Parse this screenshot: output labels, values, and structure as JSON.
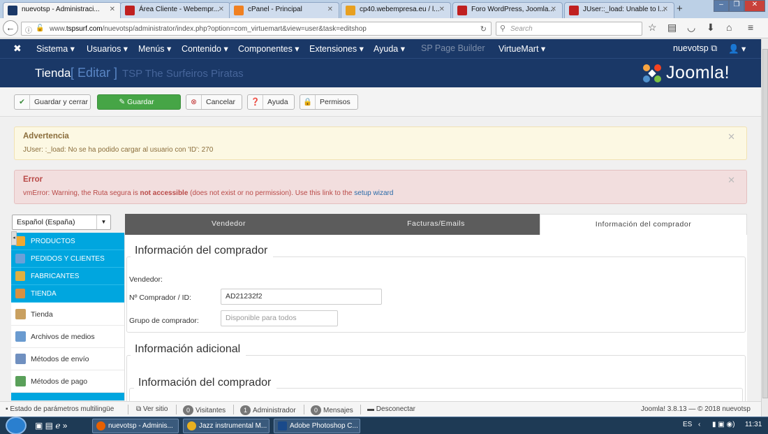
{
  "browser": {
    "tabs": [
      {
        "label": "nuevotsp - Administraci...",
        "active": true
      },
      {
        "label": "Área Cliente - Webempr...",
        "active": false
      },
      {
        "label": "cPanel - Principal",
        "active": false
      },
      {
        "label": "cp40.webempresa.eu / l...",
        "active": false
      },
      {
        "label": "Foro WordPress, Joomla...",
        "active": false
      },
      {
        "label": "JUser::_load: Unable to l...",
        "active": false
      }
    ],
    "url_prefix": "www.",
    "url_host": "tspsurf.com",
    "url_path": "/nuevotsp/administrator/index.php?option=com_virtuemart&view=user&task=editshop",
    "search_placeholder": "Search"
  },
  "topnav": {
    "items": [
      "Sistema ▾",
      "Usuarios ▾",
      "Menús ▾",
      "Contenido ▾",
      "Componentes ▾",
      "Extensiones ▾",
      "Ayuda ▾",
      "SP Page Builder",
      "VirtueMart ▾"
    ],
    "user": "nuevotsp ⧉",
    "user_menu": "👤 ▾"
  },
  "header": {
    "title": "Tienda",
    "mode": "[ Editar ]",
    "shop_name": "TSP The Surfeiros Piratas",
    "brand": "Joomla!"
  },
  "toolbar": {
    "save_close": "Guardar y cerrar",
    "save": "Guardar",
    "cancel": "Cancelar",
    "help": "Ayuda",
    "permissions": "Permisos"
  },
  "alerts": {
    "warning_title": "Advertencia",
    "warning_msg": "JUser: :_load: No se ha podido cargar al usuario con 'ID': 270",
    "error_title": "Error",
    "error_msg_a": "vmError: Warning, the Ruta segura is ",
    "error_msg_b": "not accessible",
    "error_msg_c": " (does not exist or no permission). Use this link to the ",
    "error_link": "setup wizard"
  },
  "language": {
    "selected": "Español (España)"
  },
  "sidemenu": {
    "sections": [
      {
        "label": "PRODUCTOS",
        "color": "#f0a830"
      },
      {
        "label": "PEDIDOS Y CLIENTES",
        "color": "#6aa0d8"
      },
      {
        "label": "FABRICANTES",
        "color": "#e0b040"
      },
      {
        "label": "TIENDA",
        "color": "#d89040"
      }
    ],
    "items": [
      {
        "label": "Tienda",
        "color": "#c9a060"
      },
      {
        "label": "Archivos de medios",
        "color": "#6a9bd0"
      },
      {
        "label": "Métodos de envío",
        "color": "#7090c0"
      },
      {
        "label": "Métodos de pago",
        "color": "#5aa05a"
      }
    ]
  },
  "content_tabs": [
    "Vendedor",
    "Facturas/Emails",
    "Información del comprador"
  ],
  "form": {
    "legend_buyer": "Información del comprador",
    "vendor_label": "Vendedor:",
    "buyer_id_label": "Nº Comprador / ID:",
    "buyer_id_value": "AD21232f2",
    "group_label": "Grupo de comprador:",
    "group_placeholder": "Disponible para todos",
    "legend_additional": "Información adicional",
    "legend_buyer2": "Información del comprador"
  },
  "statusbar": {
    "multilang": "Estado de parámetros multilingüe",
    "view_site": "Ver sitio",
    "visitors_count": "0",
    "visitors": "Visitantes",
    "admins_count": "1",
    "admins": "Administrador",
    "messages_count": "0",
    "messages": "Mensajes",
    "logout": "Desconectar",
    "version": "Joomla! 3.8.13 — © 2018 nuevotsp"
  },
  "taskbar": {
    "tasks": [
      "nuevotsp - Adminis...",
      "Jazz instrumental M...",
      "Adobe Photoshop C..."
    ],
    "lang": "ES",
    "time": "11:31"
  },
  "colors": {
    "joomla_navy": "#1a3867",
    "sidebar_blue": "#00a6df",
    "save_green": "#46a546"
  }
}
